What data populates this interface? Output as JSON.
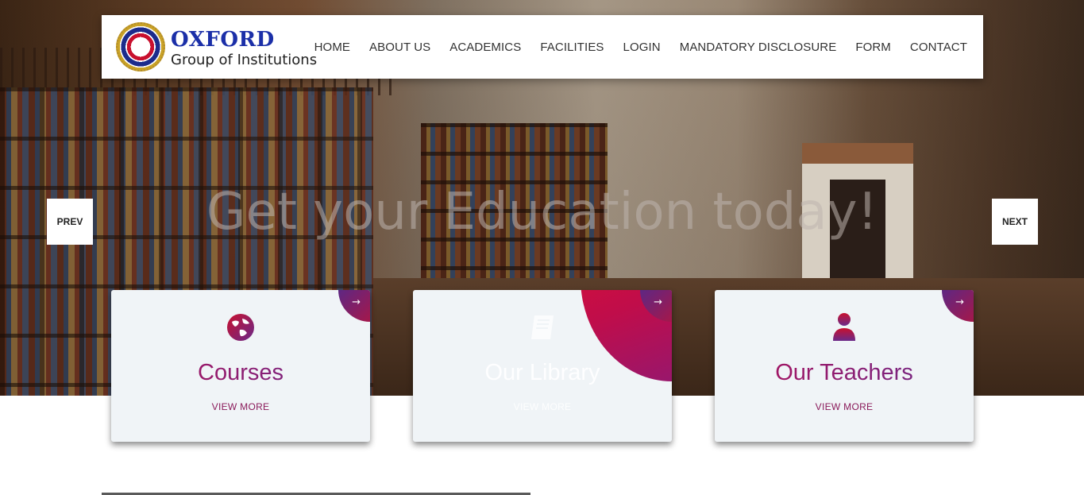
{
  "header": {
    "logo_title": "OXFORD",
    "logo_subtitle": "Group of Institutions",
    "nav": [
      {
        "label": "HOME"
      },
      {
        "label": "ABOUT US"
      },
      {
        "label": "ACADEMICS"
      },
      {
        "label": "FACILITIES"
      },
      {
        "label": "LOGIN"
      },
      {
        "label": "MANDATORY DISCLOSURE"
      },
      {
        "label": "FORM"
      },
      {
        "label": "CONTACT"
      }
    ]
  },
  "hero": {
    "headline": "Get your Education today!",
    "prev_label": "PREV",
    "next_label": "NEXT"
  },
  "cards": [
    {
      "title": "Courses",
      "link": "VIEW MORE",
      "icon": "globe-icon",
      "arrow": "→"
    },
    {
      "title": "Our Library",
      "link": "VIEW MORE",
      "icon": "book-icon",
      "arrow": "→"
    },
    {
      "title": "Our Teachers",
      "link": "VIEW MORE",
      "icon": "user-icon",
      "arrow": "→"
    }
  ],
  "colors": {
    "brand_blue": "#1b2fa8",
    "accent_red": "#c8102e",
    "accent_purple": "#6a2a8a",
    "card_bg": "#f0f4f7"
  }
}
